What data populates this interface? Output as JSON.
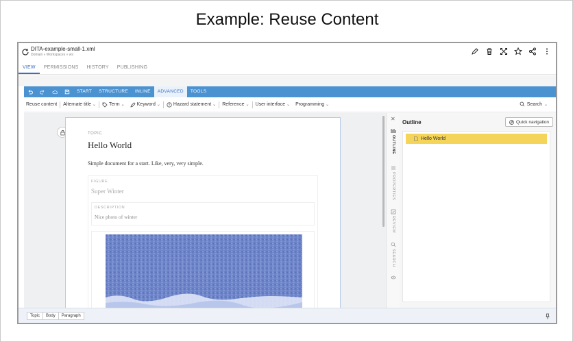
{
  "page": {
    "title": "Example: Reuse Content"
  },
  "header": {
    "file_name": "DITA-example-small-1.xml",
    "file_path": "Domain » Workspaces » ws",
    "icons": [
      "pencil-icon",
      "trash-icon",
      "crossed-arrows-icon",
      "star-icon",
      "share-icon",
      "more-vertical-icon"
    ]
  },
  "view_tabs": [
    {
      "label": "VIEW",
      "active": true
    },
    {
      "label": "PERMISSIONS"
    },
    {
      "label": "HISTORY"
    },
    {
      "label": "PUBLISHING"
    }
  ],
  "ribbon": {
    "icons": [
      "undo-icon",
      "redo-icon",
      "cloud-icon",
      "save-icon"
    ],
    "tabs": [
      {
        "label": "START"
      },
      {
        "label": "STRUCTURE"
      },
      {
        "label": "INLINE"
      },
      {
        "label": "ADVANCED",
        "active": true
      },
      {
        "label": "TOOLS"
      }
    ]
  },
  "subbar": {
    "reuse": "Reuse content",
    "alt_title": "Alternate title",
    "term": "Term",
    "keyword": "Keyword",
    "hazard": "Hazard statement",
    "reference": "Reference",
    "user_interface": "User interface",
    "programming": "Programming",
    "search": "Search"
  },
  "document": {
    "topic_label": "TOPIC",
    "title": "Hello World",
    "paragraph": "Simple document for a start. Like, very, very simple.",
    "figure_label": "FIGURE",
    "figure_title": "Super Winter",
    "description_label": "DESCRIPTION",
    "description_text": "Nice photo of winter"
  },
  "side_tabs": [
    {
      "label": "OUTLINE",
      "icon": "outline-icon",
      "active": true
    },
    {
      "label": "PROPERTIES",
      "icon": "properties-icon"
    },
    {
      "label": "REVIEW",
      "icon": "review-icon"
    },
    {
      "label": "SEARCH",
      "icon": "search-icon"
    },
    {
      "label": "",
      "icon": "code-icon"
    }
  ],
  "outline": {
    "title": "Outline",
    "quick_nav": "Quick navigation",
    "items": [
      "Hello World"
    ]
  },
  "footer": {
    "breadcrumb": [
      "Topic",
      "Body",
      "Paragraph"
    ]
  },
  "colors": {
    "ribbon": "#4b92d1",
    "accent": "#3a6fbf",
    "outline_highlight": "#f5d45a"
  }
}
